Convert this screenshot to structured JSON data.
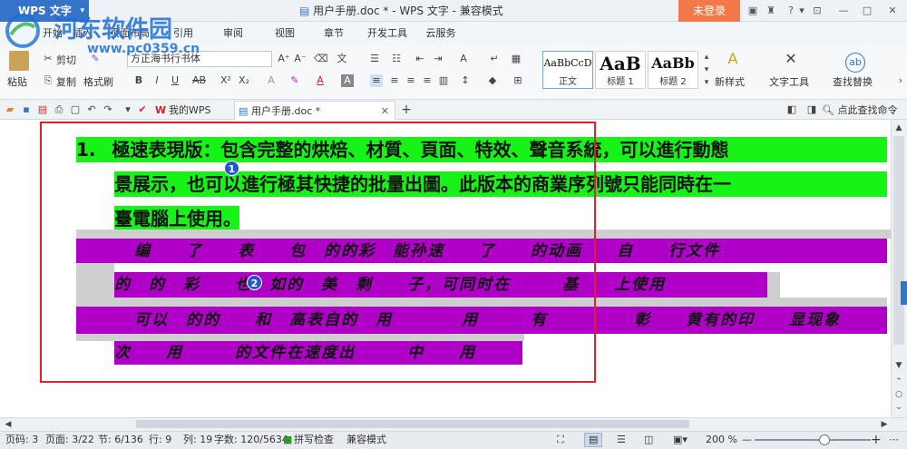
{
  "titlebar": {
    "app_name": "WPS 文字",
    "doc_title": "用户手册.doc * - WPS 文字 - 兼容模式",
    "login": "未登录",
    "help": "?"
  },
  "menu": [
    "开始",
    "插入",
    "页面布局",
    "引用",
    "审阅",
    "视图",
    "章节",
    "开发工具",
    "云服务"
  ],
  "ribbon": {
    "paste": "粘贴",
    "cut": "剪切",
    "copy": "复制",
    "format_painter": "格式刷",
    "font_name": "方正海书行书体",
    "styles": [
      {
        "sample": "AaBbCcD",
        "name": "正文"
      },
      {
        "sample": "AaB",
        "name": "标题 1"
      },
      {
        "sample": "AaBb",
        "name": "标题 2"
      }
    ],
    "new_style": "新样式",
    "text_tools": "文字工具",
    "find_replace": "查找替换"
  },
  "tabs": {
    "tab1": "我的WPS",
    "tab2": "用户手册.doc *",
    "search": "点此查找命令"
  },
  "document": {
    "para1_num": "1.",
    "para1_line1": "極速表現版：包含完整的烘焙、材質、頁面、特效、聲音系統，可以進行動態",
    "para1_line2": "景展示，也可以進行極其快捷的批量出圖。此版本的商業序列號只能同時在一",
    "para1_line3": "臺電腦上使用。",
    "script_line1": "编　　了　　表　　包　的的彩　能孙速　　了　　的动画　　自　　行文件",
    "script_line2": "的　的　彩　　也　如的　美　剩　　子，可同时在　　　基　　上使用",
    "script_line3": "可以　的的　　和　高表自的　用　　　　用　　　有　　　　　彰　　黄有的印　　显现象",
    "script_line4": "次　　用　　　的文件在速度出　　　中　　用",
    "callout1": "1",
    "callout2": "2"
  },
  "status": {
    "page_num": "页码: 3",
    "pages": "页面: 3/22",
    "section": "节: 6/136",
    "row": "行: 9",
    "col": "列: 19",
    "words": "字数: 120/5634",
    "spell": "拼写检查",
    "compat": "兼容模式",
    "zoom": "200 %",
    "zoom_minus": "—",
    "zoom_plus": "+"
  },
  "watermark": {
    "site": "河东软件园",
    "url": "www.pc0359.cn"
  },
  "colors": {
    "accent": "#3574c9",
    "login_bg": "#f27a4a",
    "highlight_green": "#17f317",
    "highlight_purple": "#b000c8",
    "annotation_red": "#e0202a"
  }
}
